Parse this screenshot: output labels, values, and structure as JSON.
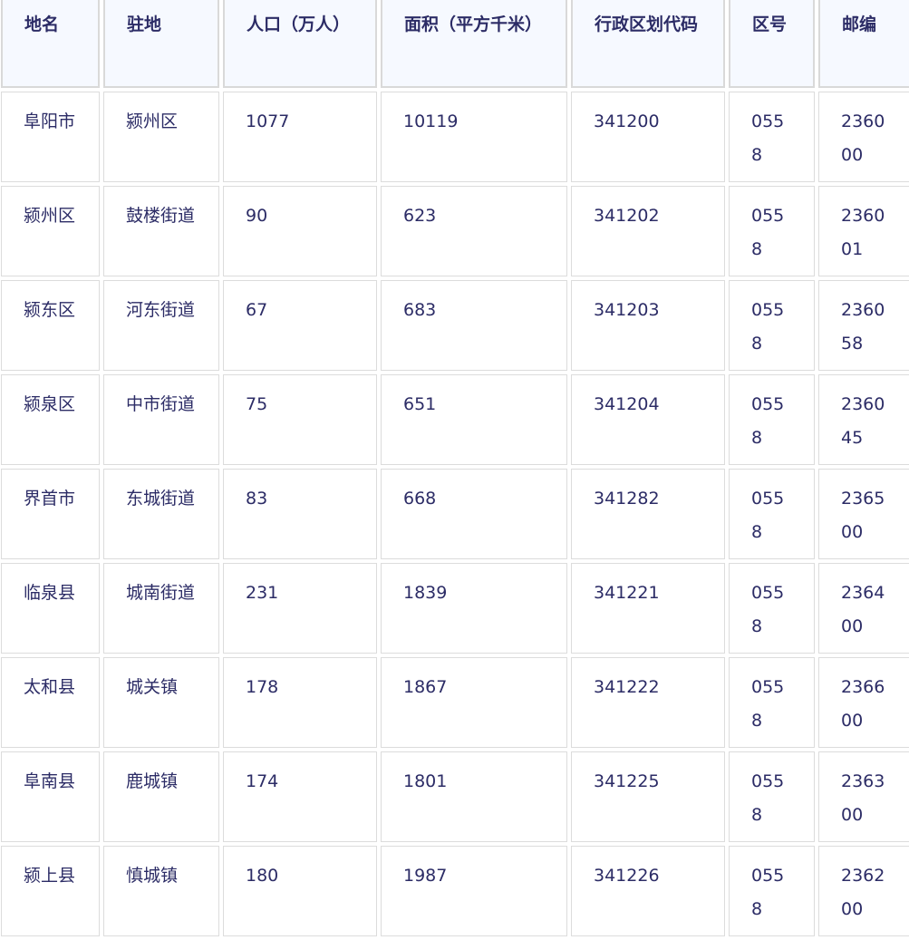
{
  "table": {
    "headers": [
      "地名",
      "驻地",
      "人口（万人）",
      "面积（平方千米）",
      "行政区划代码",
      "区号",
      "邮编"
    ],
    "rows": [
      [
        "阜阳市",
        "颍州区",
        "1077",
        "10119",
        "341200",
        "0558",
        "236000"
      ],
      [
        "颍州区",
        "鼓楼街道",
        "90",
        "623",
        "341202",
        "0558",
        "236001"
      ],
      [
        "颍东区",
        "河东街道",
        "67",
        "683",
        "341203",
        "0558",
        "236058"
      ],
      [
        "颍泉区",
        "中市街道",
        "75",
        "651",
        "341204",
        "0558",
        "236045"
      ],
      [
        "界首市",
        "东城街道",
        "83",
        "668",
        "341282",
        "0558",
        "236500"
      ],
      [
        "临泉县",
        "城南街道",
        "231",
        "1839",
        "341221",
        "0558",
        "236400"
      ],
      [
        "太和县",
        "城关镇",
        "178",
        "1867",
        "341222",
        "0558",
        "236600"
      ],
      [
        "阜南县",
        "鹿城镇",
        "174",
        "1801",
        "341225",
        "0558",
        "236300"
      ],
      [
        "颍上县",
        "慎城镇",
        "180",
        "1987",
        "341226",
        "0558",
        "236200"
      ]
    ]
  }
}
